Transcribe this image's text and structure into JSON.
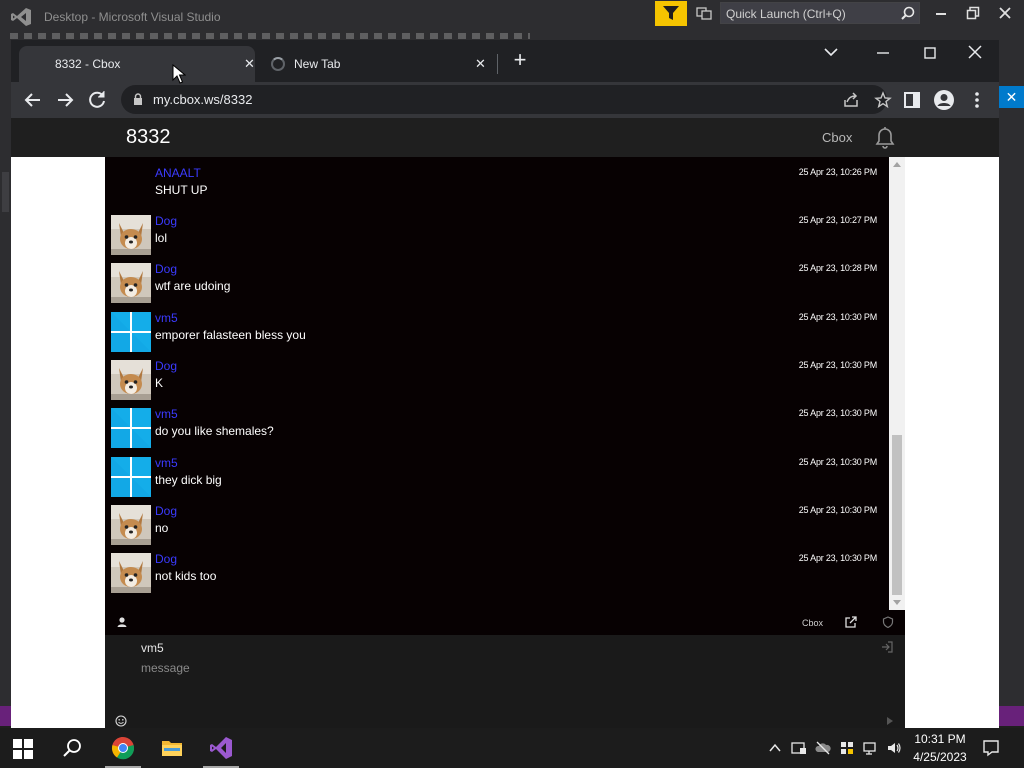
{
  "vs": {
    "title": "Desktop - Microsoft Visual Studio",
    "quick_launch_placeholder": "Quick Launch (Ctrl+Q)"
  },
  "browser": {
    "tabs": [
      {
        "title": "8332 - Cbox",
        "active": true
      },
      {
        "title": "New Tab",
        "active": false,
        "loading": true
      }
    ],
    "url": "my.cbox.ws/8332"
  },
  "cbox": {
    "box_title": "8332",
    "brand": "Cbox",
    "bar_brand": "Cbox",
    "messages": [
      {
        "name": "ANAALT",
        "text": "SHUT UP",
        "time": "25 Apr 23, 10:26 PM",
        "avatar": "none"
      },
      {
        "name": "Dog",
        "text": "lol",
        "time": "25 Apr 23, 10:27 PM",
        "avatar": "dog"
      },
      {
        "name": "Dog",
        "text": "wtf are udoing",
        "time": "25 Apr 23, 10:28 PM",
        "avatar": "dog"
      },
      {
        "name": "vm5",
        "text": "emporer falasteen bless you",
        "time": "25 Apr 23, 10:30 PM",
        "avatar": "windows"
      },
      {
        "name": "Dog",
        "text": "K",
        "time": "25 Apr 23, 10:30 PM",
        "avatar": "dog"
      },
      {
        "name": "vm5",
        "text": "do you like shemales?",
        "time": "25 Apr 23, 10:30 PM",
        "avatar": "windows"
      },
      {
        "name": "vm5",
        "text": "they dick big",
        "time": "25 Apr 23, 10:30 PM",
        "avatar": "windows"
      },
      {
        "name": "Dog",
        "text": "no",
        "time": "25 Apr 23, 10:30 PM",
        "avatar": "dog"
      },
      {
        "name": "Dog",
        "text": "not kids too",
        "time": "25 Apr 23, 10:30 PM",
        "avatar": "dog"
      }
    ],
    "form": {
      "username": "vm5",
      "message_placeholder": "message"
    }
  },
  "taskbar": {
    "time": "10:31 PM",
    "date": "4/25/2023"
  },
  "colors": {
    "name_link": "#3b3bff",
    "vs_accent": "#68217a",
    "vs_blue": "#007acc",
    "filter_yellow": "#f5c400"
  }
}
